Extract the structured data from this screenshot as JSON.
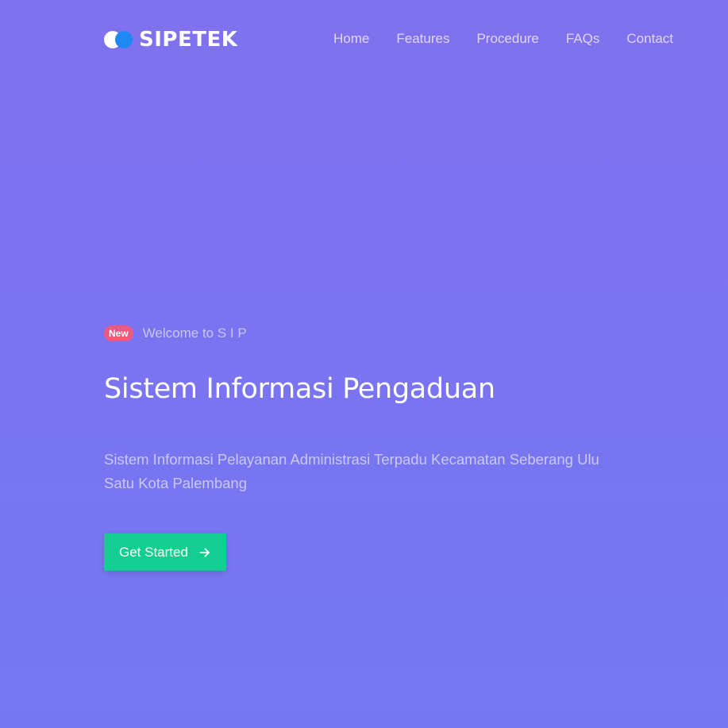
{
  "brand": {
    "name": "SIPETEK",
    "icon": "circles-logo-icon"
  },
  "nav": {
    "items": [
      {
        "label": "Home"
      },
      {
        "label": "Features"
      },
      {
        "label": "Procedure"
      },
      {
        "label": "FAQs"
      },
      {
        "label": "Contact"
      }
    ]
  },
  "hero": {
    "badge": "New",
    "welcome": "Welcome to S I P",
    "title": "Sistem Informasi Pengaduan",
    "description": "Sistem Informasi Pelayanan Administrasi Terpadu Kecamatan Seberang Ulu Satu Kota Palembang",
    "cta_label": "Get Started",
    "cta_icon": "arrow-right-icon"
  },
  "colors": {
    "background_top": "#8071ee",
    "background_bottom": "#7378f2",
    "badge": "#f2577d",
    "cta": "#12cf91",
    "logo_accent": "#1e88f5"
  }
}
